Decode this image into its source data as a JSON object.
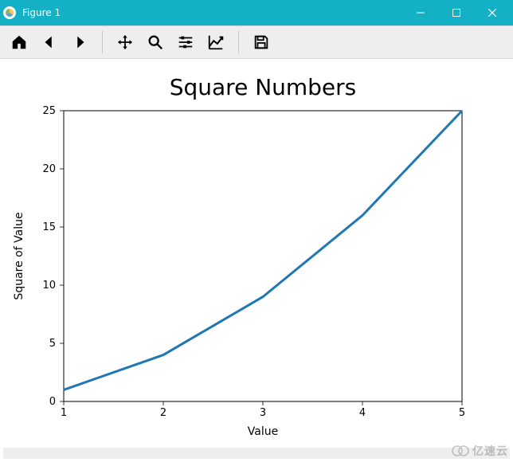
{
  "window": {
    "title": "Figure 1"
  },
  "toolbar": {
    "items": [
      {
        "name": "home-icon"
      },
      {
        "name": "back-icon"
      },
      {
        "name": "forward-icon"
      },
      {
        "sep": true
      },
      {
        "name": "pan-icon"
      },
      {
        "name": "zoom-icon"
      },
      {
        "name": "configure-subplots-icon"
      },
      {
        "name": "edit-axis-icon"
      },
      {
        "sep": true
      },
      {
        "name": "save-icon"
      }
    ]
  },
  "watermark": {
    "text": "亿速云"
  },
  "chart_data": {
    "type": "line",
    "title": "Square Numbers",
    "xlabel": "Value",
    "ylabel": "Square of Value",
    "x": [
      1,
      2,
      3,
      4,
      5
    ],
    "y": [
      1,
      4,
      9,
      16,
      25
    ],
    "xticks": [
      1,
      2,
      3,
      4,
      5
    ],
    "yticks": [
      0,
      5,
      10,
      15,
      20,
      25
    ],
    "xlim": [
      1,
      5
    ],
    "ylim": [
      0,
      25
    ],
    "line_color": "#1f77b4",
    "line_width": 3
  }
}
